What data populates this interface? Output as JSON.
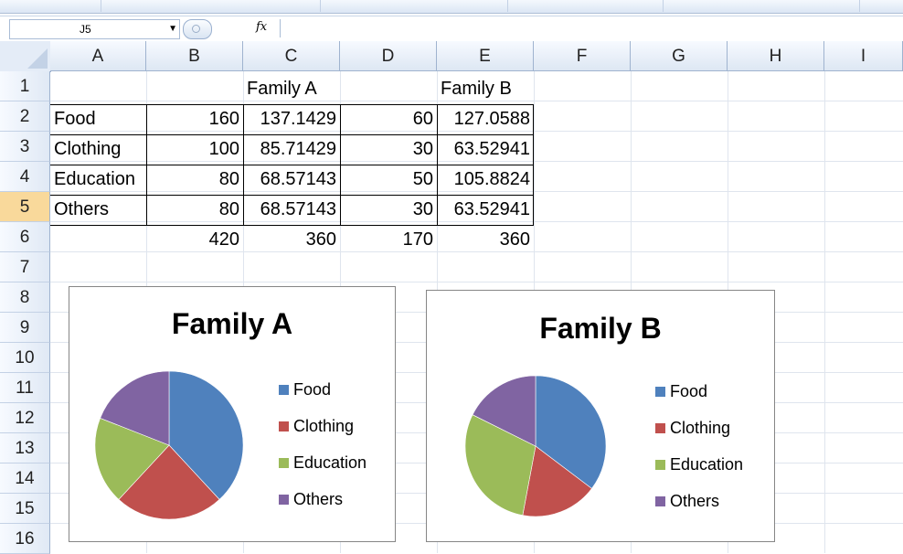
{
  "formula_bar": {
    "name_box": "J5",
    "fx_label": "fx",
    "formula": ""
  },
  "columns": [
    "A",
    "B",
    "C",
    "D",
    "E",
    "F",
    "G",
    "H",
    "I"
  ],
  "rows": [
    "1",
    "2",
    "3",
    "4",
    "5",
    "6",
    "7",
    "8",
    "9",
    "10",
    "11",
    "12",
    "13",
    "14",
    "15",
    "16"
  ],
  "cells": {
    "C1": "Family A",
    "E1": "Family B",
    "A2": "Food",
    "B2": "160",
    "C2": "137.1429",
    "D2": "60",
    "E2": "127.0588",
    "A3": "Clothing",
    "B3": "100",
    "C3": "85.71429",
    "D3": "30",
    "E3": "63.52941",
    "A4": "Education",
    "B4": "80",
    "C4": "68.57143",
    "D4": "50",
    "E4": "105.8824",
    "A5": "Others",
    "B5": "80",
    "C5": "68.57143",
    "D5": "30",
    "E5": "63.52941",
    "B6": "420",
    "C6": "360",
    "D6": "170",
    "E6": "360"
  },
  "colors": {
    "food": "#4f81bd",
    "clothing": "#c0504d",
    "education": "#9bbb59",
    "others": "#8064a2"
  },
  "chart_data": [
    {
      "type": "pie",
      "title": "Family A",
      "categories": [
        "Food",
        "Clothing",
        "Education",
        "Others"
      ],
      "values": [
        160,
        100,
        80,
        80
      ],
      "legend": "right"
    },
    {
      "type": "pie",
      "title": "Family B",
      "categories": [
        "Food",
        "Clothing",
        "Education",
        "Others"
      ],
      "values": [
        60,
        30,
        50,
        30
      ],
      "legend": "right"
    }
  ]
}
